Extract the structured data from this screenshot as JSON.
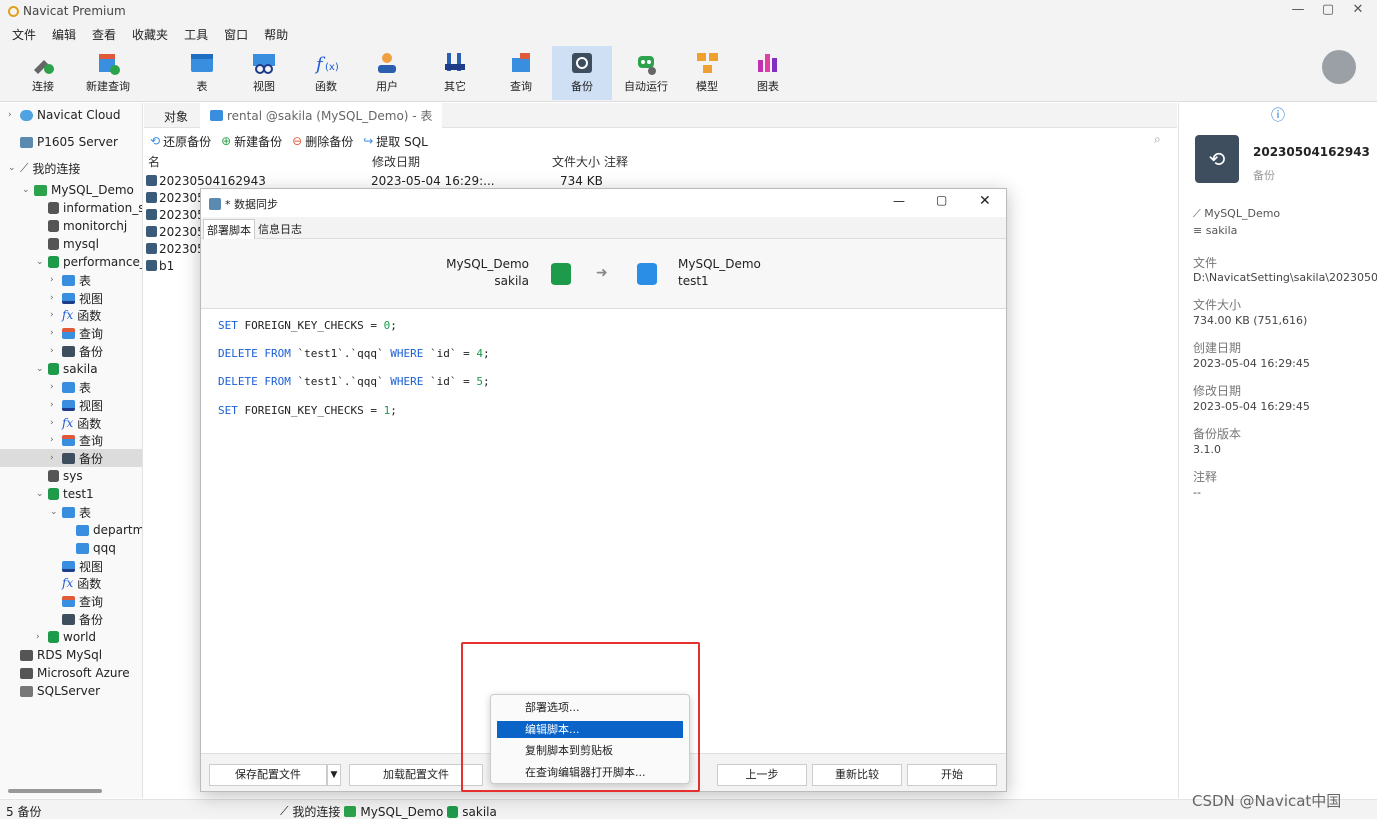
{
  "window": {
    "title": "Navicat Premium",
    "min": "—",
    "max": "▢",
    "close": "✕"
  },
  "menu": [
    "文件",
    "编辑",
    "查看",
    "收藏夹",
    "工具",
    "窗口",
    "帮助"
  ],
  "toolbar": {
    "items": [
      {
        "label": "连接",
        "icon": "connection-icon"
      },
      {
        "label": "新建查询",
        "icon": "new-query-icon"
      },
      {
        "label": "表",
        "icon": "table-icon"
      },
      {
        "label": "视图",
        "icon": "view-icon"
      },
      {
        "label": "函数",
        "icon": "function-icon"
      },
      {
        "label": "用户",
        "icon": "user-icon"
      },
      {
        "label": "其它",
        "icon": "other-icon"
      },
      {
        "label": "查询",
        "icon": "query-icon"
      },
      {
        "label": "备份",
        "icon": "backup-icon"
      },
      {
        "label": "自动运行",
        "icon": "automation-icon"
      },
      {
        "label": "模型",
        "icon": "model-icon"
      },
      {
        "label": "图表",
        "icon": "chart-icon"
      }
    ]
  },
  "tree": [
    {
      "label": "Navicat Cloud",
      "indent": 0,
      "chev": ">"
    },
    {
      "label": "P1605 Server",
      "indent": 0,
      "chev": ""
    },
    {
      "label": "我的连接",
      "indent": 0,
      "chev": "v"
    },
    {
      "label": "MySQL_Demo",
      "indent": 1,
      "chev": "v"
    },
    {
      "label": "information_sc",
      "indent": 2,
      "chev": ""
    },
    {
      "label": "monitorchj",
      "indent": 2,
      "chev": ""
    },
    {
      "label": "mysql",
      "indent": 2,
      "chev": ""
    },
    {
      "label": "performance_s",
      "indent": 2,
      "chev": "v"
    },
    {
      "label": "表",
      "indent": 3,
      "chev": ">"
    },
    {
      "label": "视图",
      "indent": 3,
      "chev": ">"
    },
    {
      "label": "函数",
      "indent": 3,
      "chev": ">"
    },
    {
      "label": "查询",
      "indent": 3,
      "chev": ">"
    },
    {
      "label": "备份",
      "indent": 3,
      "chev": ">"
    },
    {
      "label": "sakila",
      "indent": 2,
      "chev": "v"
    },
    {
      "label": "表",
      "indent": 3,
      "chev": ">"
    },
    {
      "label": "视图",
      "indent": 3,
      "chev": ">"
    },
    {
      "label": "函数",
      "indent": 3,
      "chev": ">"
    },
    {
      "label": "查询",
      "indent": 3,
      "chev": ">"
    },
    {
      "label": "备份",
      "indent": 3,
      "chev": ">",
      "selected": true
    },
    {
      "label": "sys",
      "indent": 2,
      "chev": ""
    },
    {
      "label": "test1",
      "indent": 2,
      "chev": "v"
    },
    {
      "label": "表",
      "indent": 3,
      "chev": "v"
    },
    {
      "label": "departme",
      "indent": 4,
      "chev": ""
    },
    {
      "label": "qqq",
      "indent": 4,
      "chev": ""
    },
    {
      "label": "视图",
      "indent": 3,
      "chev": ""
    },
    {
      "label": "函数",
      "indent": 3,
      "chev": ""
    },
    {
      "label": "查询",
      "indent": 3,
      "chev": ""
    },
    {
      "label": "备份",
      "indent": 3,
      "chev": ""
    },
    {
      "label": "world",
      "indent": 2,
      "chev": ">"
    },
    {
      "label": "RDS MySql",
      "indent": 0,
      "chev": ""
    },
    {
      "label": "Microsoft Azure",
      "indent": 0,
      "chev": ""
    },
    {
      "label": "SQLServer",
      "indent": 0,
      "chev": ""
    }
  ],
  "tabs": {
    "objects": "对象",
    "rental": "rental @sakila (MySQL_Demo) - 表"
  },
  "subtoolbar": {
    "restore": "还原备份",
    "new": "新建备份",
    "delete": "删除备份",
    "extract": "提取 SQL"
  },
  "filelist": {
    "headers": {
      "name": "名",
      "modified": "修改日期",
      "size": "文件大小",
      "comment": "注释"
    },
    "rows": [
      {
        "name": "20230504162943",
        "modified": "2023-05-04 16:29:...",
        "size": "734 KB"
      },
      {
        "name": "202305",
        "modified": "",
        "size": ""
      },
      {
        "name": "202305",
        "modified": "",
        "size": ""
      },
      {
        "name": "202305",
        "modified": "",
        "size": ""
      },
      {
        "name": "202305",
        "modified": "",
        "size": ""
      },
      {
        "name": "b1",
        "modified": "",
        "size": ""
      }
    ]
  },
  "info": {
    "title": "20230504162943",
    "subtitle": "备份",
    "connection": "MySQL_Demo",
    "database": "sakila",
    "file_label": "文件",
    "file_value": "D:\\NavicatSetting\\sakila\\2023050",
    "size_label": "文件大小",
    "size_value": "734.00 KB (751,616)",
    "created_label": "创建日期",
    "created_value": "2023-05-04 16:29:45",
    "modified_label": "修改日期",
    "modified_value": "2023-05-04 16:29:45",
    "version_label": "备份版本",
    "version_value": "3.1.0",
    "comment_label": "注释",
    "comment_value": "--"
  },
  "status": {
    "count": "5 备份",
    "conn": "我的连接",
    "server": "MySQL_Demo",
    "db": "sakila"
  },
  "dialog": {
    "title": "* 数据同步",
    "tabs": [
      "部署脚本",
      "信息日志"
    ],
    "source": {
      "server": "MySQL_Demo",
      "db": "sakila"
    },
    "target": {
      "server": "MySQL_Demo",
      "db": "test1"
    },
    "code": [
      {
        "kw": "SET",
        "rest": " FOREIGN_KEY_CHECKS = ",
        "n": "0",
        ";": ";"
      },
      {
        "kw": "DELETE FROM",
        "rest": " `test1`.`qqq` ",
        "kw2": "WHERE",
        "rest2": " `id` = ",
        "n": "4"
      },
      {
        "kw": "DELETE FROM",
        "rest": " `test1`.`qqq` ",
        "kw2": "WHERE",
        "rest2": " `id` = ",
        "n": "5"
      },
      {
        "kw": "SET",
        "rest": " FOREIGN_KEY_CHECKS = ",
        "n": "1"
      }
    ],
    "buttons": {
      "save": "保存配置文件",
      "load": "加载配置文件",
      "prev": "上一步",
      "compare": "重新比较",
      "start": "开始"
    }
  },
  "context_menu": [
    "部署选项...",
    "编辑脚本...",
    "复制脚本到剪贴板",
    "在查询编辑器打开脚本..."
  ],
  "watermark": "CSDN @Navicat中国"
}
